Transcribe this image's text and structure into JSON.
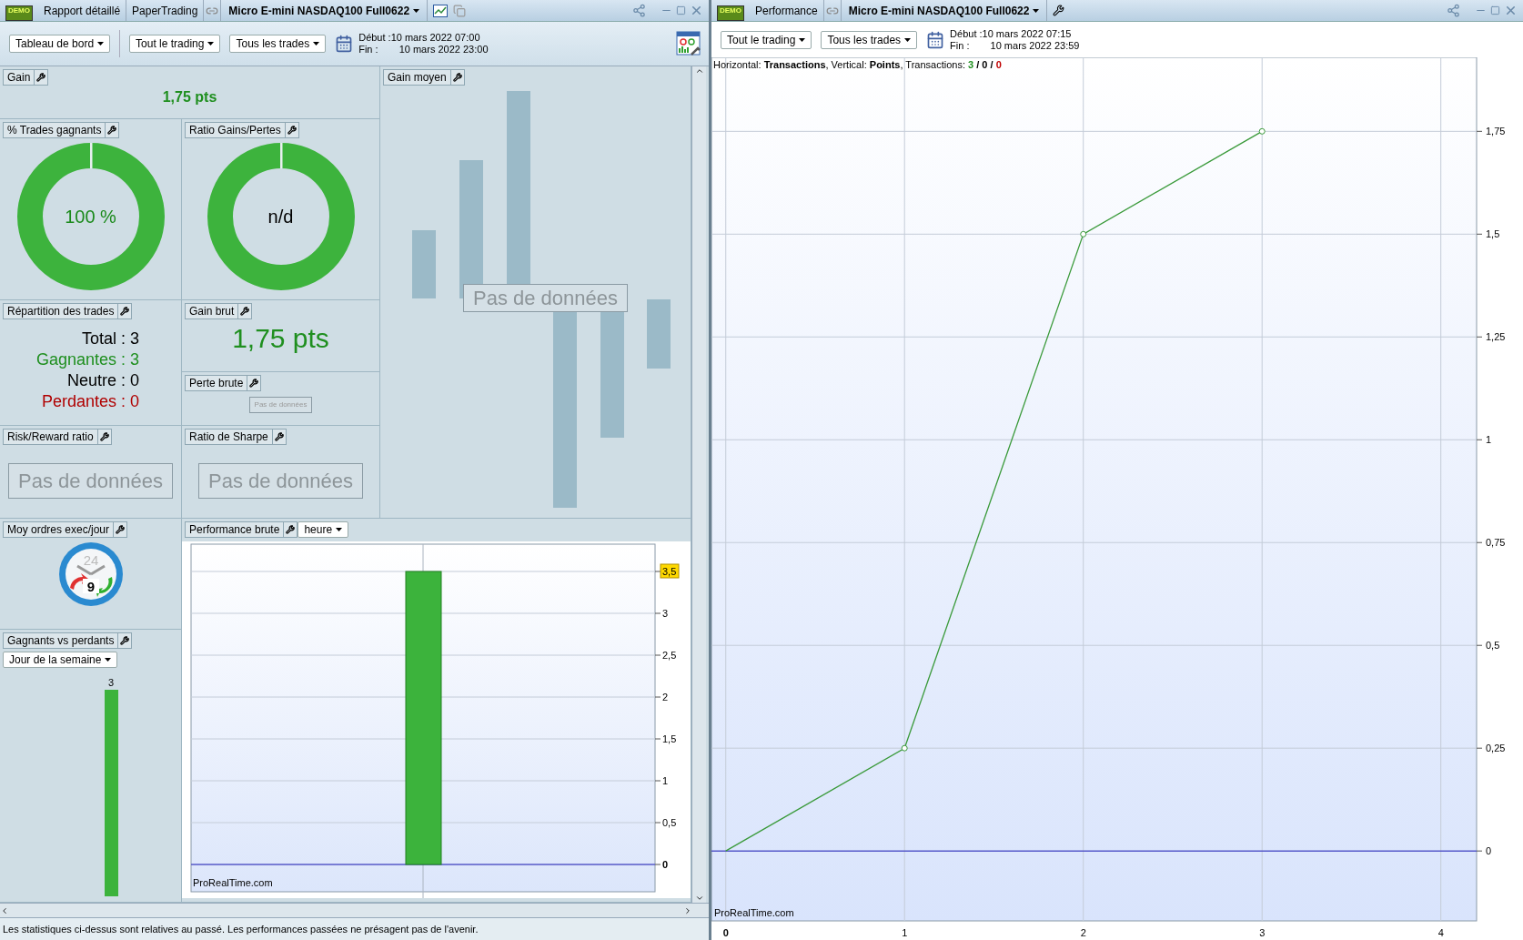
{
  "left_window": {
    "logo_text": "DEMO",
    "title_items": [
      "Rapport détaillé",
      "PaperTrading"
    ],
    "instrument": "Micro E-mini NASDAQ100 Full0622",
    "toolbar": {
      "dropdowns": [
        "Tableau de bord",
        "Tout le trading",
        "Tous les trades"
      ],
      "start_label": "Début :",
      "start": "10 mars 2022 07:00",
      "end_label": "Fin :",
      "end": "10 mars 2022 23:00"
    },
    "gain": {
      "title": "Gain",
      "value": "1,75 pts"
    },
    "gain_moyen": {
      "title": "Gain moyen",
      "message": "Pas de données"
    },
    "win_rate": {
      "title": "% Trades gagnants",
      "value": "100 %"
    },
    "ratio": {
      "title": "Ratio Gains/Pertes",
      "value": "n/d"
    },
    "distribution": {
      "title": "Répartition des trades",
      "rows": [
        {
          "text": "Total : 3",
          "kind": "total"
        },
        {
          "text": "Gagnantes : 3",
          "kind": "win"
        },
        {
          "text": "Neutre : 0",
          "kind": "neutral"
        },
        {
          "text": "Perdantes : 0",
          "kind": "loss"
        }
      ]
    },
    "gain_brut": {
      "title": "Gain brut",
      "value": "1,75 pts"
    },
    "perte_brute": {
      "title": "Perte brute",
      "message": "Pas de données"
    },
    "risk_reward": {
      "title": "Risk/Reward ratio",
      "message": "Pas de données"
    },
    "sharpe": {
      "title": "Ratio de Sharpe",
      "message": "Pas de données"
    },
    "orders": {
      "title": "Moy ordres exec/jour",
      "dial": "24",
      "value": "9"
    },
    "winners_losers": {
      "title": "Gagnants vs perdants",
      "dropdown": "Jour de la semaine",
      "bar_label": "3"
    },
    "performance_brute": {
      "title": "Performance brute",
      "dropdown": "heure",
      "credit": "ProRealTime.com",
      "chart_data": {
        "type": "bar",
        "values": [
          3.5
        ],
        "ylim": [
          0,
          3.5
        ],
        "grid": true,
        "ref_lines": [
          {
            "axis": "y",
            "value": 0,
            "color": "#2020c0"
          }
        ],
        "yticks": [
          0,
          {
            "value": 0.5,
            "label": "0,5"
          },
          1,
          {
            "value": 1.5,
            "label": "1,5"
          },
          2,
          {
            "value": 2.5,
            "label": "2,5"
          },
          3,
          {
            "value": 3.5,
            "label": "3,5"
          }
        ]
      }
    },
    "footer": "Les statistiques ci-dessus sont relatives au passé. Les performances passées ne présagent pas de l'avenir."
  },
  "right_window": {
    "logo_text": "DEMO",
    "title": "Performance",
    "instrument": "Micro E-mini NASDAQ100 Full0622",
    "toolbar": {
      "dropdowns": [
        "Tout le trading",
        "Tous les trades"
      ],
      "start_label": "Début :",
      "start": "10 mars 2022 07:15",
      "end_label": "Fin :",
      "end": "10 mars 2022 23:59"
    },
    "chart_info": {
      "text": "Horizontal: **Transactions**, Vertical: **Points**, Transactions:",
      "separator": "/",
      "counts": [
        {
          "value": "3",
          "color": "#1f8f1f"
        },
        {
          "value": "0",
          "color": "#000000"
        },
        {
          "value": "0",
          "color": "#c00000"
        }
      ]
    },
    "credit": "ProRealTime.com",
    "chart_data": {
      "type": "line",
      "x": [
        0,
        1,
        2,
        3
      ],
      "series": [
        {
          "color": "#3a9a3a",
          "values": [
            0,
            0.25,
            1.5,
            1.75
          ]
        }
      ],
      "xlim": [
        -0.08,
        4.2
      ],
      "ylim": [
        -0.17,
        1.93
      ],
      "grid": true,
      "ref_lines": [
        {
          "axis": "y",
          "value": 0,
          "color": "#2020c0"
        }
      ],
      "xticks": [
        0,
        1,
        2,
        3,
        4
      ],
      "yticks": [
        0,
        {
          "value": 0.25,
          "label": "0,25"
        },
        {
          "value": 0.5,
          "label": "0,5"
        },
        {
          "value": 0.75,
          "label": "0,75"
        },
        1,
        {
          "value": 1.25,
          "label": "1,25"
        },
        {
          "value": 1.5,
          "label": "1,5"
        },
        {
          "value": 1.75,
          "label": "1,75"
        }
      ]
    }
  }
}
